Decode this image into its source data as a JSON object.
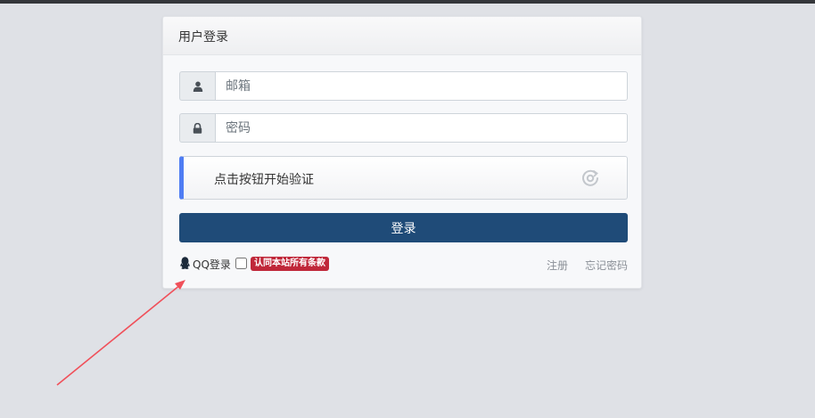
{
  "header": {
    "title": "用户登录"
  },
  "form": {
    "email_placeholder": "邮箱",
    "password_placeholder": "密码",
    "captcha_label": "点击按钮开始验证",
    "login_label": "登录"
  },
  "footer": {
    "qq_login": "QQ登录",
    "terms_badge": "认同本站所有条款",
    "register": "注册",
    "forgot_password": "忘记密码"
  },
  "icons": {
    "email": "user-icon",
    "password": "lock-icon",
    "captcha": "refresh-icon",
    "qq": "qq-icon"
  },
  "colors": {
    "login_button": "#1f4b78",
    "captcha_accent": "#4f7df3",
    "terms_badge": "#c0283a",
    "annotation_arrow": "#f0505a"
  }
}
